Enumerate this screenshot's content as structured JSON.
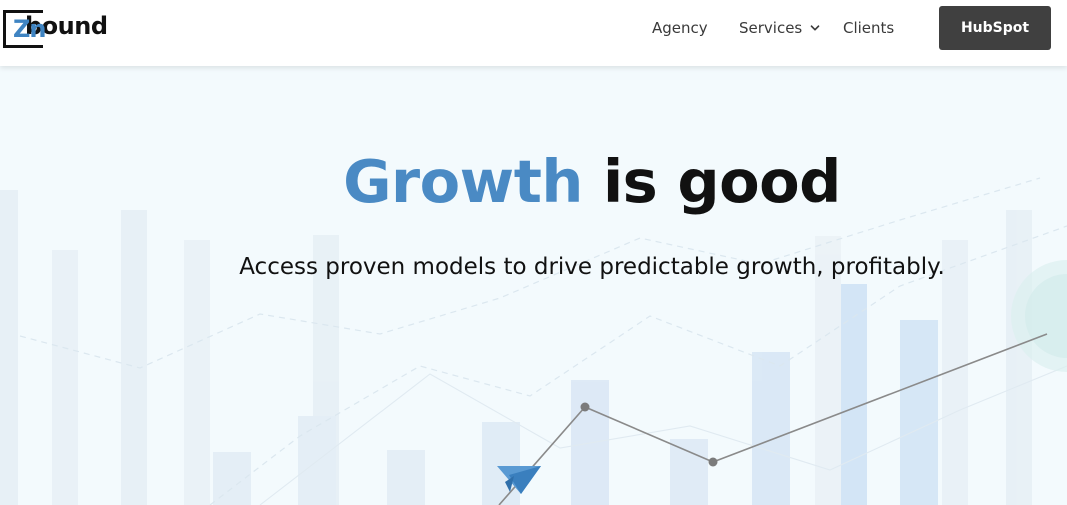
{
  "brand": {
    "logo_prefix": "Zn",
    "logo_text": "bound",
    "accent_color": "#4a8ac4",
    "dark_color": "#111111"
  },
  "nav": {
    "items": [
      {
        "label": "Agency"
      },
      {
        "label": "Services"
      },
      {
        "label": "Clients"
      }
    ],
    "cta_label": "HubSpot",
    "cta_color": "#404040"
  },
  "hero": {
    "headline_accent": "Growth",
    "headline_rest": "is good",
    "subheadline": "Access proven models to drive predictable growth, profitably."
  },
  "icons": [
    "chevron-down-icon",
    "paper-plane-icon"
  ]
}
